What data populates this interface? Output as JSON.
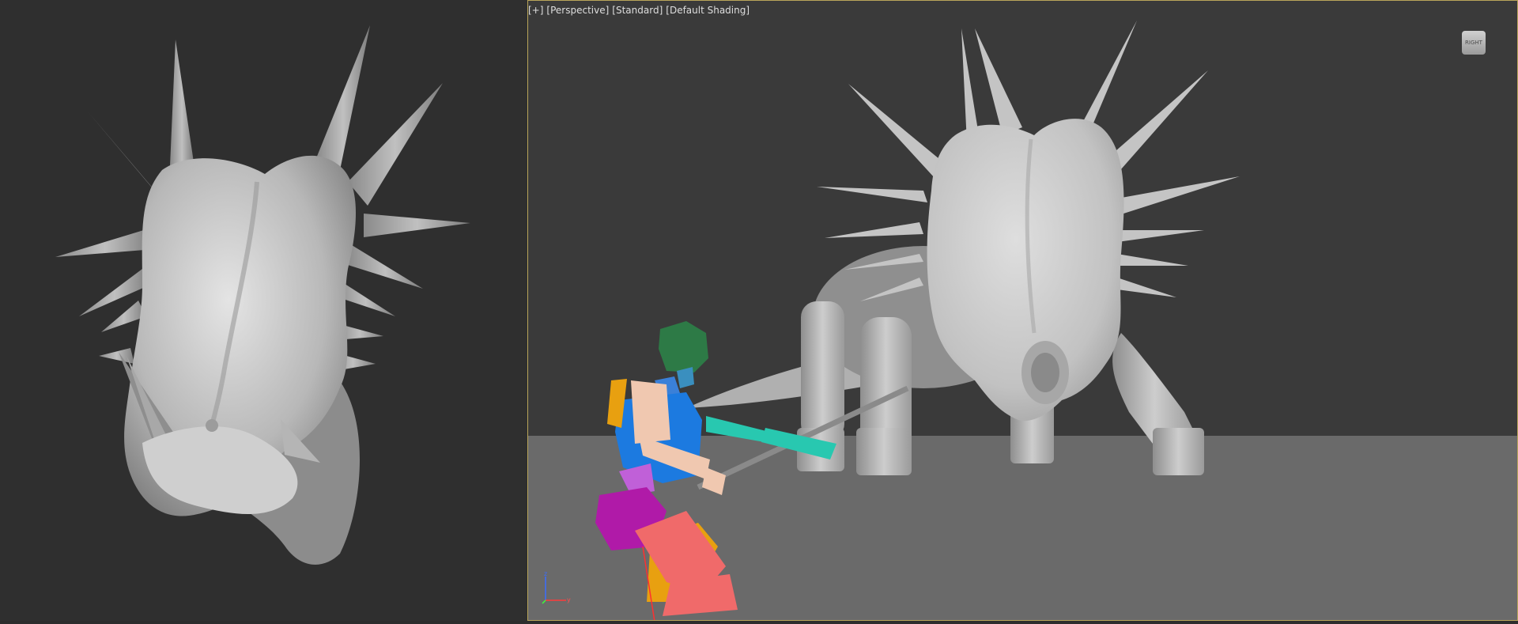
{
  "viewport": {
    "menu_symbol": "[+]",
    "view_type": "[Perspective]",
    "render_mode": "[Standard]",
    "shading_mode": "[Default Shading]",
    "viewcube_label": "RIGHT",
    "axis_labels": {
      "z": "z",
      "y": "y"
    }
  },
  "colors": {
    "background": "#2d2d2d",
    "viewport_background": "#3a3a3a",
    "ground": "#6a6a6a",
    "model_gray": "#c7c7c7",
    "border_active": "#b9a55a",
    "mannequin_head": "#2d7a46",
    "mannequin_torso": "#1c7ae0",
    "mannequin_arm": "#f0c8b0",
    "mannequin_forearm": "#28c8b0",
    "mannequin_pelvis": "#b01aa8",
    "mannequin_leg": "#f06a6a",
    "mannequin_leg_back": "#e8a010"
  }
}
